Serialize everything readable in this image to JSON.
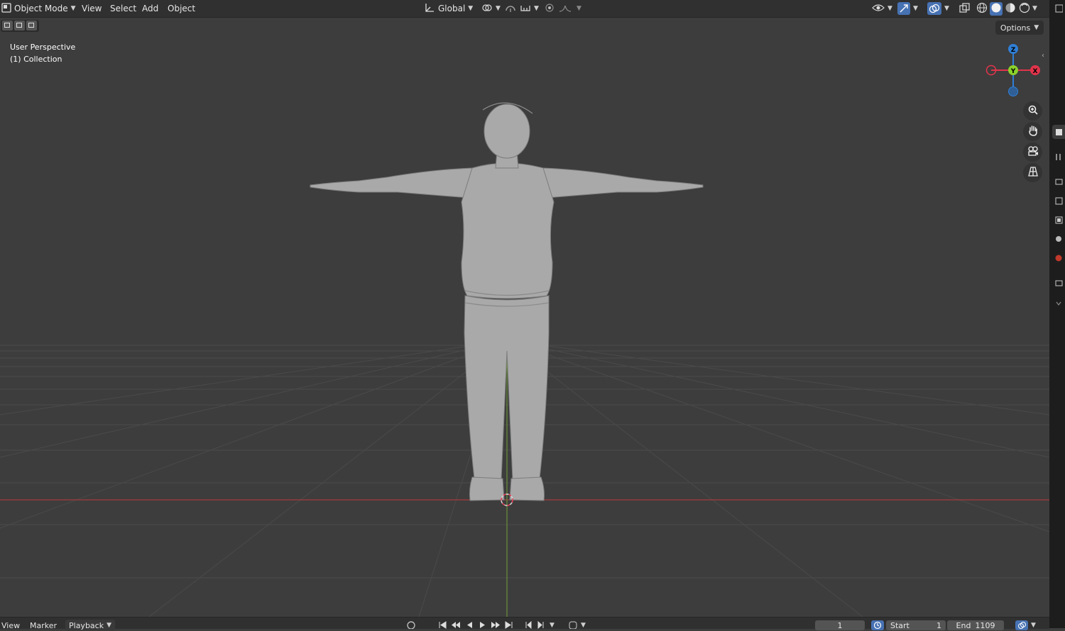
{
  "header": {
    "mode": "Object Mode",
    "menus": [
      "View",
      "Select",
      "Add",
      "Object"
    ],
    "orientation": "Global"
  },
  "viewport": {
    "view_name": "User Perspective",
    "collection": "(1) Collection",
    "options_label": "Options",
    "gizmo_labels": {
      "z": "Z",
      "y": "Y",
      "x": "X"
    }
  },
  "timeline": {
    "menus": [
      "View",
      "Marker",
      "Playback"
    ],
    "current_frame": "1",
    "start_label": "Start",
    "start_value": "1",
    "end_label": "End",
    "end_value": "1109"
  },
  "colors": {
    "accent_blue": "#4772b3",
    "axis_x": "#e2344b",
    "axis_y": "#8bd12b",
    "axis_z": "#2f7fd6"
  },
  "icons": [
    "editor-type-icon",
    "transform-orientation-icon",
    "pivot-icon",
    "snap-icon",
    "proportional-edit-icon",
    "visibility-icon",
    "gizmo-icon",
    "overlay-icon",
    "xray-icon",
    "shading-wireframe-icon",
    "shading-solid-icon",
    "shading-material-icon",
    "shading-rendered-icon",
    "zoom-icon",
    "pan-hand-icon",
    "camera-icon",
    "ortho-grid-icon"
  ]
}
